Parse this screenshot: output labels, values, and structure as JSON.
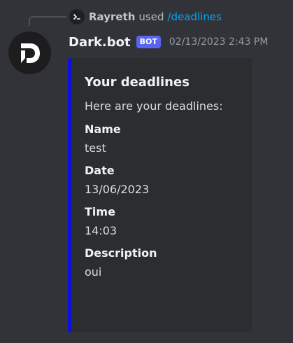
{
  "command": {
    "user": "Rayreth",
    "used_text": "used",
    "name": "/deadlines",
    "icon": "terminal-icon"
  },
  "author": {
    "avatar_icon": "dark-bot-logo",
    "name": "Dark.bot",
    "badge": "BOT",
    "timestamp": "02/13/2023 2:43 PM"
  },
  "embed": {
    "accent_color": "#0b0ee0",
    "title": "Your deadlines",
    "description": "Here are your deadlines:",
    "fields": [
      {
        "name": "Name",
        "value": "test"
      },
      {
        "name": "Date",
        "value": "13/06/2023"
      },
      {
        "name": "Time",
        "value": "14:03"
      },
      {
        "name": "Description",
        "value": "oui"
      }
    ]
  }
}
